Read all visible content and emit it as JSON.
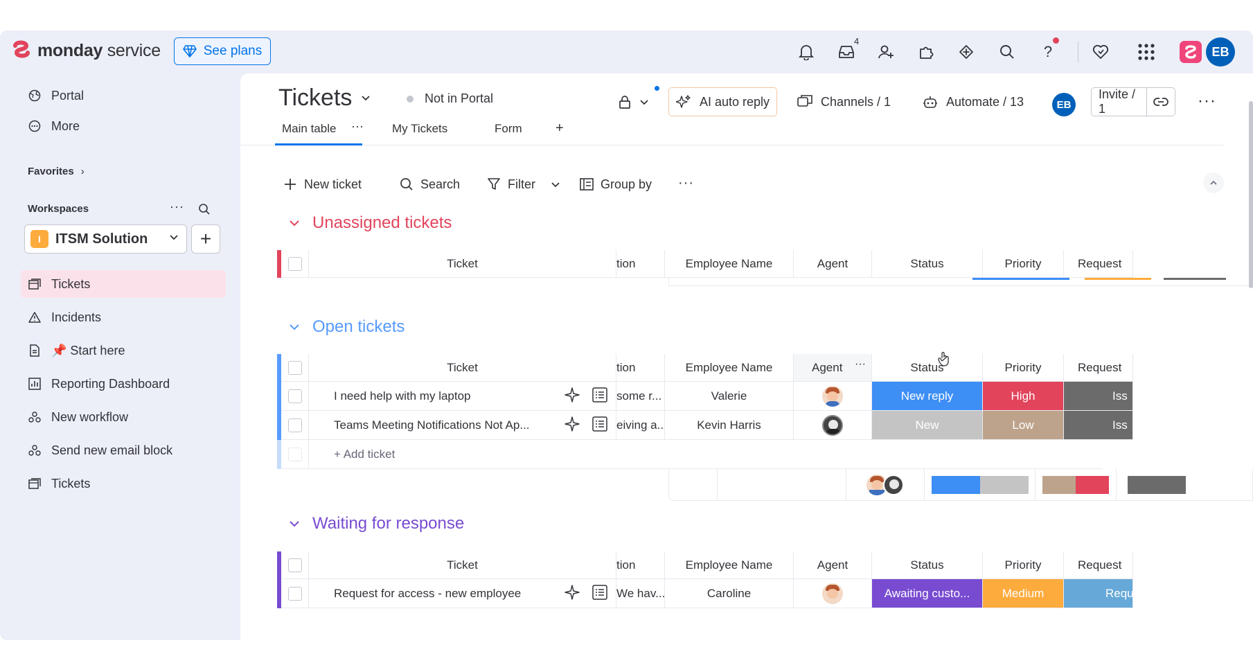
{
  "app": {
    "brand_bold": "monday",
    "brand_light": "service",
    "see_plans": "See plans"
  },
  "topbar": {
    "inbox_count": "4",
    "avatar": "EB"
  },
  "sidebar": {
    "top_items": [
      {
        "label": "Portal"
      },
      {
        "label": "More"
      }
    ],
    "favorites": "Favorites",
    "workspaces": "Workspaces",
    "workspace_name": "ITSM Solution",
    "workspace_badge": "I",
    "items": [
      {
        "label": "Tickets"
      },
      {
        "label": "Incidents"
      },
      {
        "label": "📌 Start here"
      },
      {
        "label": "Reporting Dashboard"
      },
      {
        "label": "New workflow"
      },
      {
        "label": "Send new email block"
      },
      {
        "label": "Tickets"
      }
    ]
  },
  "board": {
    "title": "Tickets",
    "portal_status": "Not in Portal",
    "ai_auto_reply": "AI auto reply",
    "channels": "Channels / 1",
    "automate": "Automate / 13",
    "avatar": "EB",
    "invite": "Invite / 1",
    "tabs": [
      {
        "label": "Main table"
      },
      {
        "label": "My Tickets"
      },
      {
        "label": "Form"
      }
    ],
    "tab_add": "+",
    "toolbar": {
      "new_ticket": "New ticket",
      "search": "Search",
      "filter": "Filter",
      "group_by": "Group by"
    }
  },
  "columns": {
    "ticket": "Ticket",
    "description": "tion",
    "employee": "Employee Name",
    "agent": "Agent",
    "status": "Status",
    "priority": "Priority",
    "request": "Request"
  },
  "groups": [
    {
      "title": "Unassigned tickets",
      "color": "#e2445c",
      "rows": []
    },
    {
      "title": "Open tickets",
      "color": "#579bfc",
      "rows": [
        {
          "ticket": "I need help with my laptop",
          "desc": "some r...",
          "employee": "Valerie",
          "status": "New reply",
          "status_color": "#3d8ef5",
          "priority": "High",
          "priority_color": "#e2445c",
          "request": "Iss",
          "request_color": "#6b6b6b"
        },
        {
          "ticket": "Teams Meeting Notifications Not Ap...",
          "desc": "eiving a...",
          "employee": "Kevin Harris",
          "status": "New",
          "status_color": "#c4c4c4",
          "priority": "Low",
          "priority_color": "#bda38b",
          "request": "Iss",
          "request_color": "#6b6b6b"
        }
      ],
      "add_label": "+ Add ticket"
    },
    {
      "title": "Waiting for response",
      "color": "#784bd1",
      "rows": [
        {
          "ticket": "Request for access - new employee",
          "desc": "We hav...",
          "employee": "Caroline",
          "status": "Awaiting custo...",
          "status_color": "#784bd1",
          "priority": "Medium",
          "priority_color": "#fdab3d",
          "request": "Requ",
          "request_color": "#66a8d8"
        }
      ]
    }
  ]
}
